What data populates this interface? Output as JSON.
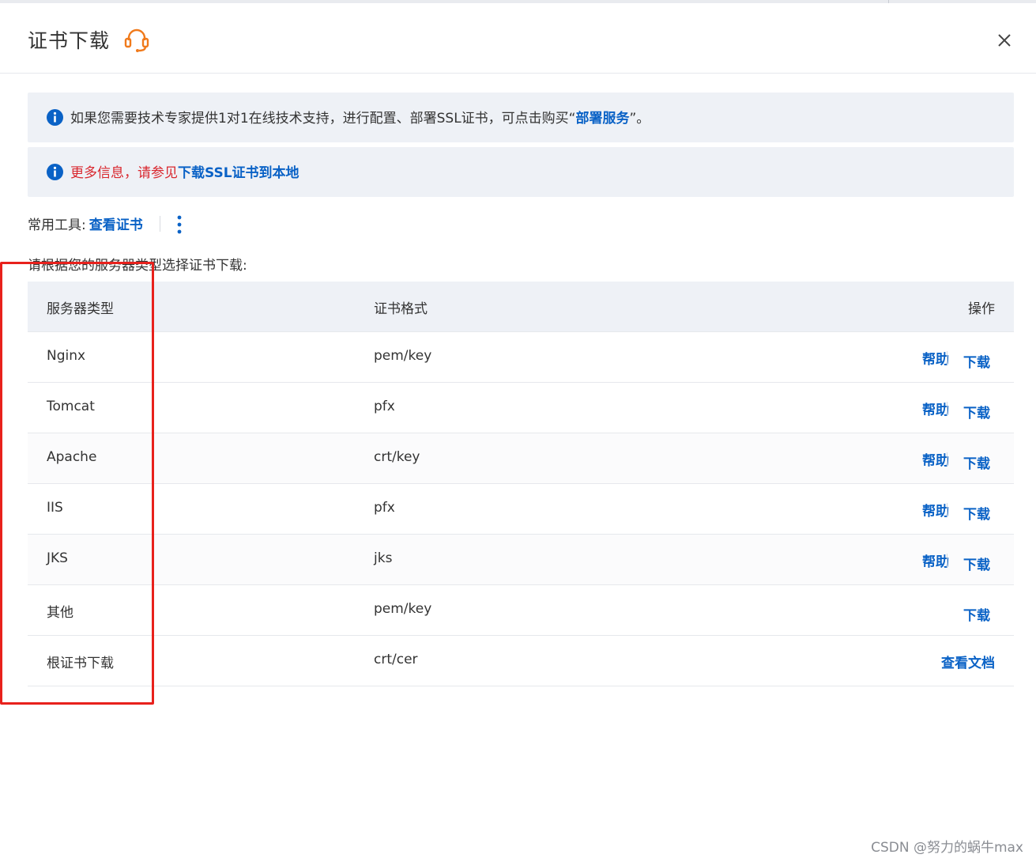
{
  "dialog": {
    "title": "证书下载",
    "close_label": "×"
  },
  "notices": {
    "tech_support": {
      "prefix": "如果您需要技术专家提供1对1在线技术支持，进行配置、部署SSL证书，可点击购买“",
      "link": "部署服务",
      "suffix": "”。"
    },
    "more_info": {
      "prefix": "更多信息，请参见",
      "link": "下载SSL证书到本地"
    }
  },
  "tools": {
    "label": "常用工具:",
    "view_cert": "查看证书"
  },
  "instruction": "请根据您的服务器类型选择证书下载:",
  "table": {
    "headers": {
      "server_type": "服务器类型",
      "format": "证书格式",
      "actions": "操作"
    },
    "rows": [
      {
        "server": "Nginx",
        "format": "pem/key",
        "help": "帮助",
        "download": "下载"
      },
      {
        "server": "Tomcat",
        "format": "pfx",
        "help": "帮助",
        "download": "下载"
      },
      {
        "server": "Apache",
        "format": "crt/key",
        "help": "帮助",
        "download": "下载"
      },
      {
        "server": "IIS",
        "format": "pfx",
        "help": "帮助",
        "download": "下载"
      },
      {
        "server": "JKS",
        "format": "jks",
        "help": "帮助",
        "download": "下载"
      },
      {
        "server": "其他",
        "format": "pem/key",
        "download": "下载"
      },
      {
        "server": "根证书下载",
        "format": "crt/cer",
        "doc": "查看文档"
      }
    ]
  },
  "watermark": "CSDN @努力的蜗牛max",
  "colors": {
    "link": "#0a62c6",
    "warning_text": "#d9272e",
    "support_icon": "#f07a1b",
    "annotation_border": "#e8211c",
    "notice_bg": "#eef1f6"
  },
  "icons": {
    "support": "headset-icon",
    "close": "close-icon",
    "info": "info-circle-icon",
    "more": "vertical-ellipsis-icon"
  }
}
